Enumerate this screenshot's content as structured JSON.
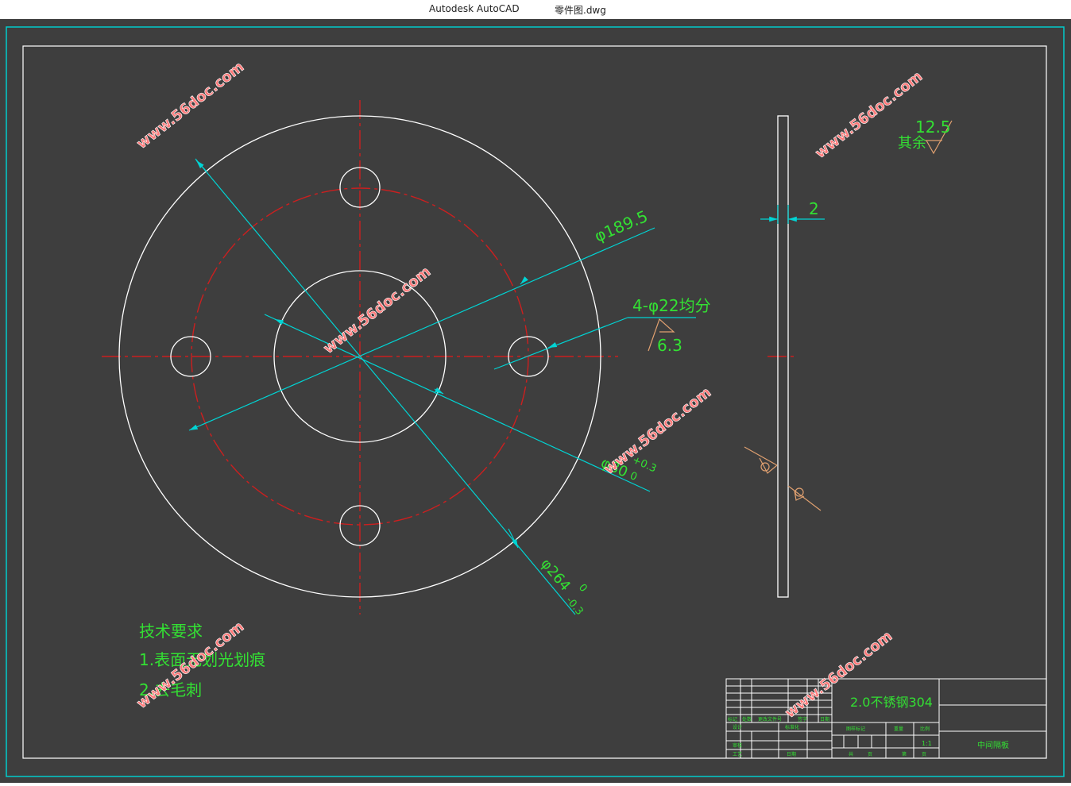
{
  "window": {
    "app_name": "Autodesk AutoCAD",
    "file_name": "零件图.dwg"
  },
  "colors": {
    "background": "#3e3e3e",
    "geometry": "#ffffff",
    "centerline": "#cc1f1f",
    "dimension": "#00d4d4",
    "text": "#33e033",
    "symbol": "#e0a070",
    "frame": "#00cccc"
  },
  "watermark": "www.56doc.com",
  "drawing": {
    "dims": {
      "d189": "φ189.5",
      "holes": "4-φ22均分",
      "roughness_holes": "6.3",
      "thickness": "2",
      "d80": "φ80",
      "d80_tol_upper": "+0.3",
      "d80_tol_lower": "0",
      "d264": "φ264",
      "d264_tol_upper": "0",
      "d264_tol_lower": "-0.3"
    },
    "roughness": {
      "label": "其余",
      "value": "12.5"
    },
    "notes": {
      "title": "技术要求",
      "line1": "1.表面无划光划痕",
      "line2": "2.去毛刺"
    }
  },
  "titleblock": {
    "material": "2.0不锈钢304",
    "part_name": "中间隔板",
    "scale": "1:1",
    "small_labels": [
      "标记",
      "处数",
      "更改文件号",
      "签字",
      "日期",
      "设计",
      "标准化",
      "审核",
      "工艺",
      "日期",
      "图样标记",
      "重量",
      "比例",
      "共",
      "页",
      "第",
      "页"
    ]
  }
}
